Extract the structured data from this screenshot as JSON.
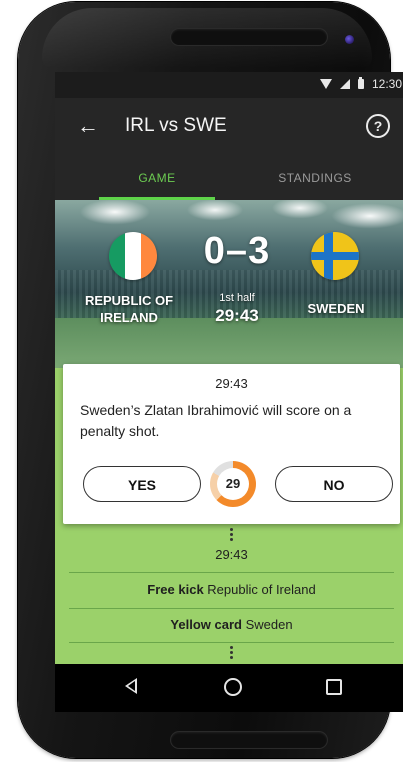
{
  "status_bar": {
    "time": "12:30",
    "icons": [
      "wifi-icon",
      "signal-icon",
      "battery-icon"
    ]
  },
  "app_bar": {
    "title": "IRL vs SWE",
    "back_icon": "←",
    "help_icon": "?"
  },
  "tabs": [
    {
      "label": "GAME",
      "active": true
    },
    {
      "label": "STANDINGS",
      "active": false
    }
  ],
  "match": {
    "home_team": "REPUBLIC OF IRELAND",
    "away_team": "SWEDEN",
    "score": "0–3",
    "period": "1st half",
    "clock": "29:43"
  },
  "prediction_card": {
    "time": "29:43",
    "question": "Sweden’s Zlatan Ibrahimović will score on a penalty shot.",
    "yes_label": "YES",
    "no_label": "NO",
    "countdown": "29"
  },
  "feed": {
    "time": "29:43",
    "events": [
      {
        "type": "Free kick",
        "team": "Republic of Ireland"
      },
      {
        "type": "Yellow card",
        "team": "Sweden"
      }
    ]
  },
  "colors": {
    "accent_green": "#6ccc52",
    "feed_green": "#9bd16a",
    "timer_orange": "#f38a2a"
  }
}
